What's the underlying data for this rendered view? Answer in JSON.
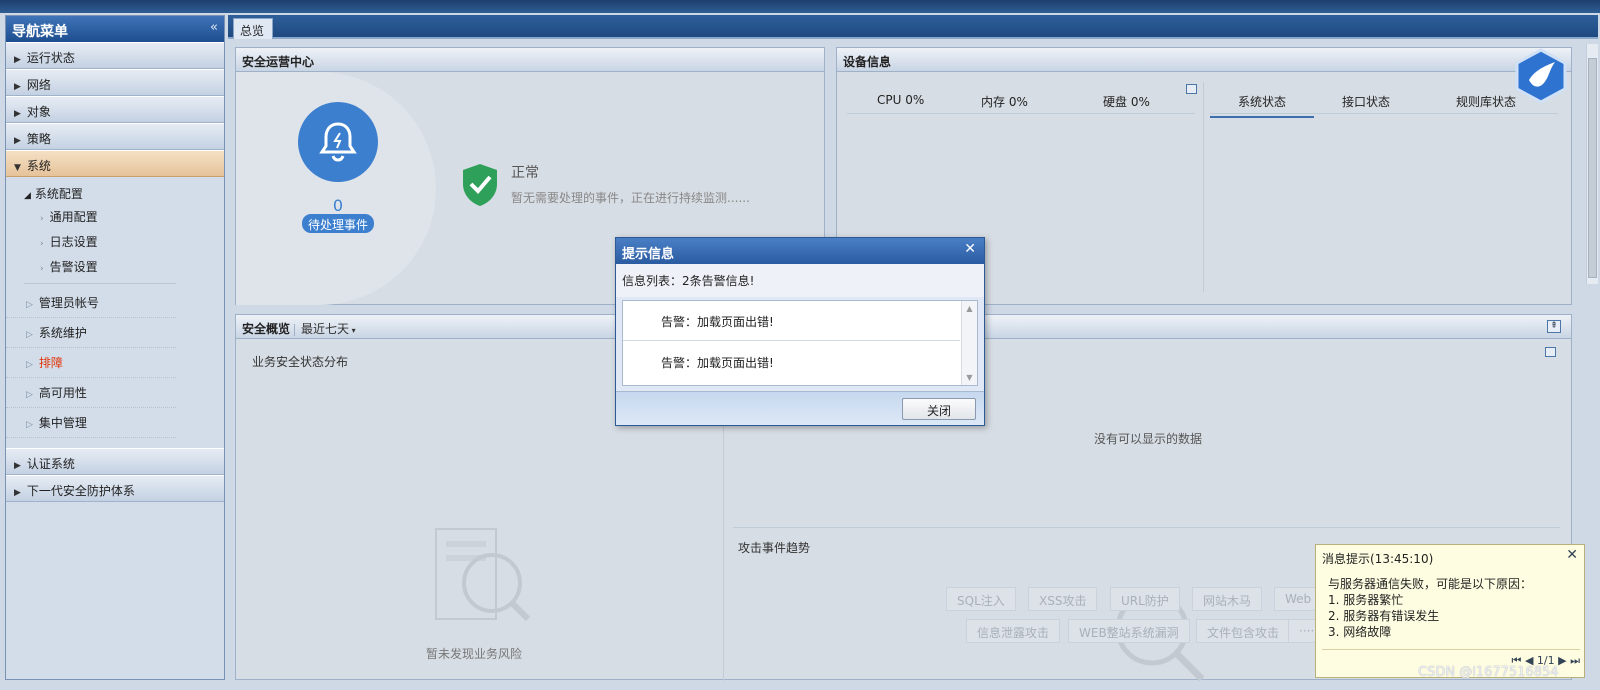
{
  "sidebar": {
    "title": "导航菜单",
    "collapse_glyph": "«",
    "sections_top": [
      {
        "label": "运行状态"
      },
      {
        "label": "网络"
      },
      {
        "label": "对象"
      },
      {
        "label": "策略"
      }
    ],
    "active_section": {
      "label": "系统"
    },
    "system_group": {
      "label": "系统配置"
    },
    "system_leaves": [
      "通用配置",
      "日志设置",
      "告警设置"
    ],
    "system_nodes": [
      {
        "label": "管理员帐号"
      },
      {
        "label": "系统维护"
      },
      {
        "label": "排障",
        "color": "#e0360b"
      },
      {
        "label": "高可用性"
      },
      {
        "label": "集中管理"
      }
    ],
    "sections_bottom": [
      {
        "label": "认证系统"
      },
      {
        "label": "下一代安全防护体系"
      }
    ]
  },
  "tabs": [
    {
      "label": "总览"
    }
  ],
  "soc": {
    "title": "安全运营中心",
    "pending_count": "0",
    "pending_label": "待处理事件",
    "status_title": "正常",
    "status_desc": "暂无需要处理的事件，正在进行持续监测......"
  },
  "device": {
    "title": "设备信息",
    "cpu": "CPU 0%",
    "memory": "内存 0%",
    "disk": "硬盘 0%",
    "tabs": [
      "系统状态",
      "接口状态",
      "规则库状态"
    ]
  },
  "overview": {
    "title": "安全概览",
    "range": "最近七天",
    "biz_title": "业务安全状态分布",
    "biz_empty": "暂未发现业务风险",
    "no_data": "没有可以显示的数据",
    "attack_title": "攻击事件趋势",
    "attack_tags": [
      "SQL注入",
      "XSS攻击",
      "URL防护",
      "网站木马",
      "Web",
      "信息泄露攻击",
      "WEB整站系统漏洞",
      "文件包含攻击",
      "····"
    ]
  },
  "dialog": {
    "title": "提示信息",
    "info": "信息列表：2条告警信息!",
    "items": [
      "告警：加载页面出错!",
      "告警：加载页面出错!"
    ],
    "close_label": "关闭",
    "close_x": "✕"
  },
  "toast": {
    "title": "消息提示(13:45:10)",
    "close_x": "✕",
    "lines": [
      "与服务器通信失败，可能是以下原因：",
      "1. 服务器繁忙",
      "2. 服务器有错误发生",
      "3. 网络故障"
    ],
    "pager": "1/1"
  },
  "watermark": "CSDN @l1677516854"
}
